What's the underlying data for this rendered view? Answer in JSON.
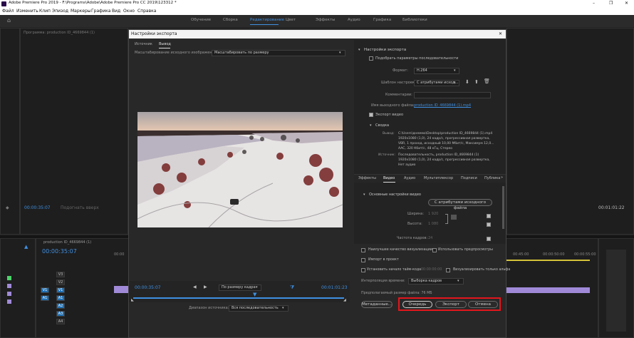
{
  "app": {
    "title": "Adobe Premiere Pro 2019 - F:\\Programs\\Adobe\\Adobe Premiere Pro CC 2019\\123312 *"
  },
  "window_controls": {
    "minimize": "–",
    "maximize": "❐",
    "close": "✕"
  },
  "menu": [
    "Файл",
    "Изменить",
    "Клип",
    "Эпизод",
    "Маркеры",
    "Графика",
    "Вид",
    "Окно",
    "Справка"
  ],
  "workspaces": [
    "Обучение",
    "Сборка",
    "Редактирование",
    "Цвет",
    "Эффекты",
    "Аудио",
    "Графика",
    "Библиотеки"
  ],
  "active_workspace_index": 2,
  "source_panel": {
    "title": "Программа: production ID_4669844 (1)",
    "timecode_left": "00:00:35:07",
    "fit_label": "Подогнать вверх",
    "timecode_right": "00:01:01:22"
  },
  "timeline": {
    "title": "production ID_4669844 (1)",
    "timecode": "00:00:35:07",
    "ruler": [
      "00:00",
      "00:45:00",
      "00:00:50:00",
      "00:00:55:00"
    ],
    "tracks": [
      {
        "label": "V3",
        "toggle": "V3"
      },
      {
        "label": "V2",
        "toggle": "V2"
      },
      {
        "label": "V1",
        "toggle": "V1",
        "selected": true
      },
      {
        "label": "A1",
        "toggle": "A1",
        "selected": true
      },
      {
        "label": "A2",
        "toggle": "A2"
      },
      {
        "label": "A3",
        "toggle": "A3"
      },
      {
        "label": "A4",
        "toggle": "A4"
      }
    ]
  },
  "dialog": {
    "title": "Настройки экспорта",
    "close": "✕",
    "tabs": [
      "Источник",
      "Вывод"
    ],
    "active_tab": 1,
    "scale_label": "Масштабирование исходного изображения:",
    "scale_value": "Масштабировать по размеру",
    "playback": {
      "timecode_in": "00:00:35:07",
      "fit_value": "По размеру кадра",
      "timecode_out": "00:01:01:23"
    },
    "source_range_label": "Диапазон источника:",
    "source_range_value": "Вся последовательность",
    "export_settings": {
      "header": "Настройки экспорта",
      "match_sequence": "Подобрать параметры последовательности",
      "format_label": "Формат:",
      "format_value": "H.264",
      "preset_label": "Шаблон настроек:",
      "preset_value": "С атрибутами исход...",
      "comments_label": "Комментарии:",
      "output_name_label": "Имя выходного файла:",
      "output_name_value": "production ID_4669844 (1).mp4",
      "export_video": "Экспорт видео",
      "summary_header": "Сводка",
      "output_label": "Вывод:",
      "output_text": [
        "C:\\Users\\днеммо\\Desktop\\production ID_4669844 (1).mp4",
        "1920x1080 (1,0), 24 кадр/с, прогрессивная развертка,",
        "VBR, 1 проход, исходный 10,00 Мбит/с, Максимум 12,0...",
        "AAC, 320 Кбит/с, 48 кГц, Стерео"
      ],
      "source_label": "Источник:",
      "source_text": [
        "Последовательность, production ID_4669844 (1)",
        "1920x1080 (1,0), 24 кадр/с, прогрессивная развертка,",
        "Нет аудио"
      ]
    },
    "subtabs": [
      "Эффекты",
      "Видео",
      "Аудио",
      "Мультиплексор",
      "Подписи",
      "Публика"
    ],
    "active_subtab": 1,
    "video_section": {
      "header": "Основные настройки видео",
      "match_button": "С атрибутами исходного файла",
      "width_label": "Ширина:",
      "width_value": "1 920",
      "height_label": "Высота:",
      "height_value": "1 080",
      "framerate_label": "Частота кадров:",
      "framerate_value": "24"
    },
    "options": {
      "max_render": "Наилучшее качество визуализации",
      "use_previews": "Использовать предпросмотры",
      "import_project": "Импорт в проект",
      "set_start_tc": "Установить начало тайм-кода",
      "start_tc_value": "00:00:00:00",
      "alpha_only": "Визуализировать только альфа",
      "interp_label": "Интерполяция времени:",
      "interp_value": "Выборка кадров",
      "file_size": "Предполагаемый размер файла:  76 МБ"
    },
    "buttons": {
      "metadata": "Метаданные...",
      "queue": "Очередь",
      "export": "Экспорт",
      "cancel": "Отмена"
    }
  },
  "colors": {
    "accent": "#3f8fe0",
    "highlight": "#e3161c",
    "purple": "#a08ad8"
  }
}
